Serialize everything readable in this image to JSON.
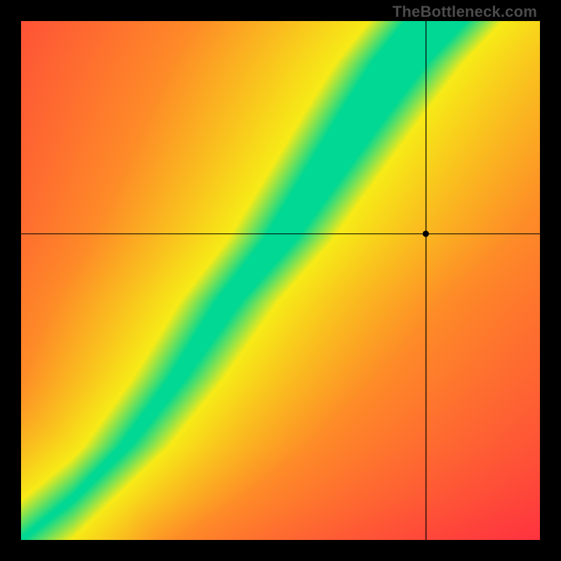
{
  "watermark": "TheBottleneck.com",
  "chart_data": {
    "type": "heatmap",
    "title": "",
    "xlabel": "",
    "ylabel": "",
    "xlim": [
      0,
      1
    ],
    "ylim": [
      0,
      1
    ],
    "colormap": "red-yellow-green (green = no bottleneck)",
    "optimal_ridge_description": "narrow diagonal band of green (balanced CPU/GPU), concave, steeper near top",
    "crosshair": {
      "x": 0.78,
      "y": 0.59,
      "note": "marked reference point, sits to the right of the green/yellow ridge in orange region"
    },
    "ridge_samples": [
      {
        "x": 0.0,
        "y": 0.0
      },
      {
        "x": 0.1,
        "y": 0.08
      },
      {
        "x": 0.2,
        "y": 0.18
      },
      {
        "x": 0.3,
        "y": 0.31
      },
      {
        "x": 0.4,
        "y": 0.46
      },
      {
        "x": 0.5,
        "y": 0.58
      },
      {
        "x": 0.58,
        "y": 0.7
      },
      {
        "x": 0.66,
        "y": 0.82
      },
      {
        "x": 0.73,
        "y": 0.92
      },
      {
        "x": 0.8,
        "y": 1.0
      }
    ]
  },
  "colors": {
    "green": "#00D893",
    "yellow": "#F7EB17",
    "orange": "#FE8B28",
    "red": "#FE2244",
    "black": "#000000"
  }
}
